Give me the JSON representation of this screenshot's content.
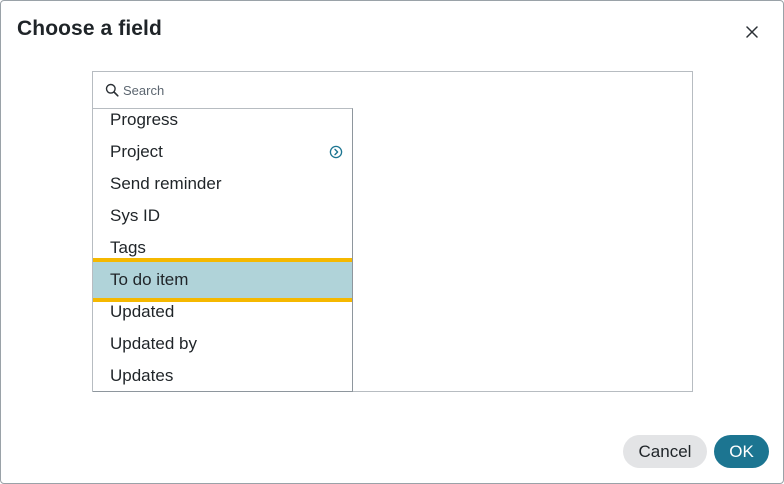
{
  "dialog": {
    "title": "Choose a field"
  },
  "search": {
    "placeholder": "Search",
    "value": ""
  },
  "list": {
    "items": [
      {
        "label": "Progress",
        "has_children": false,
        "selected": false
      },
      {
        "label": "Project",
        "has_children": true,
        "selected": false
      },
      {
        "label": "Send reminder",
        "has_children": false,
        "selected": false
      },
      {
        "label": "Sys ID",
        "has_children": false,
        "selected": false
      },
      {
        "label": "Tags",
        "has_children": false,
        "selected": false
      },
      {
        "label": "To do item",
        "has_children": false,
        "selected": true
      },
      {
        "label": "Updated",
        "has_children": false,
        "selected": false
      },
      {
        "label": "Updated by",
        "has_children": false,
        "selected": false
      },
      {
        "label": "Updates",
        "has_children": false,
        "selected": false
      }
    ]
  },
  "footer": {
    "cancel_label": "Cancel",
    "ok_label": "OK"
  },
  "colors": {
    "selected_background": "#b0d3d9",
    "selection_outline": "#f5b800",
    "primary_button": "#1c7591",
    "secondary_button": "#e3e4e6",
    "expand_icon": "#1c7591"
  },
  "icons": {
    "close": "close-icon",
    "search": "search-icon",
    "expand": "chevron-right-circle-icon"
  }
}
